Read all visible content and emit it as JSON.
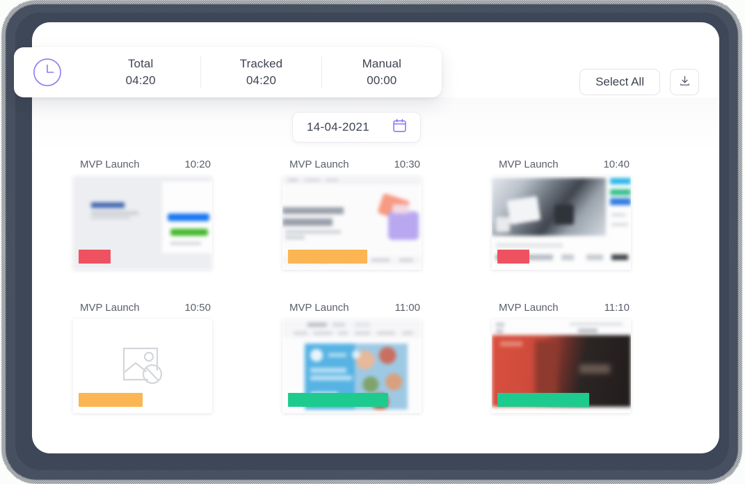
{
  "header": {
    "clock_icon": "clock-icon",
    "stats": [
      {
        "label": "Total",
        "value": "04:20"
      },
      {
        "label": "Tracked",
        "value": "04:20"
      },
      {
        "label": "Manual",
        "value": "00:00"
      }
    ],
    "select_all_label": "Select All",
    "download_icon": "download-icon"
  },
  "date_picker": {
    "value": "14-04-2021",
    "calendar_icon": "calendar-icon"
  },
  "colors": {
    "accent_purple": "#7c6ef2",
    "red": "#ee5260",
    "orange": "#fbb552",
    "green": "#1ecb8f",
    "text": "#3d4350",
    "frame": "#3d4757"
  },
  "screenshots": [
    {
      "title": "MVP Launch",
      "time": "10:20",
      "activity_color": "#ee5260",
      "activity_width": 25,
      "image": "facebook-page-thumbnail",
      "missing": false
    },
    {
      "title": "MVP Launch",
      "time": "10:30",
      "activity_color": "#fbb552",
      "activity_width": 62,
      "image": "article-page-thumbnail",
      "missing": false
    },
    {
      "title": "MVP Launch",
      "time": "10:40",
      "activity_color": "#ee5260",
      "activity_width": 25,
      "image": "meeting-photo-thumbnail",
      "missing": false
    },
    {
      "title": "MVP Launch",
      "time": "10:50",
      "activity_color": "#fbb552",
      "activity_width": 50,
      "image": "no-image-placeholder",
      "missing": true
    },
    {
      "title": "MVP Launch",
      "time": "11:00",
      "activity_color": "#1ecb8f",
      "activity_width": 78,
      "image": "blue-banner-thumbnail",
      "missing": false
    },
    {
      "title": "MVP Launch",
      "time": "11:10",
      "activity_color": "#1ecb8f",
      "activity_width": 72,
      "image": "red-hero-thumbnail",
      "missing": false
    }
  ]
}
